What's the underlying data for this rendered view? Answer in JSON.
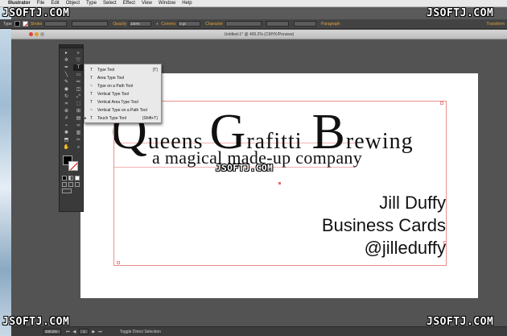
{
  "menubar": {
    "items": [
      "Illustrator",
      "File",
      "Edit",
      "Object",
      "Type",
      "Select",
      "Effect",
      "View",
      "Window",
      "Help"
    ]
  },
  "controlbar": {
    "tool_label": "Type",
    "stroke_label": "Stroke",
    "opacity_label": "Opacity",
    "opacity_value": "100%",
    "corners_label": "Corners",
    "corners_value": "0 pt",
    "character_label": "Character",
    "paragraph_label": "Paragraph",
    "transform_label": "Transform"
  },
  "document": {
    "title": "Untitled-1* @ 400.2% (CMYK/Preview)"
  },
  "artwork": {
    "line1_caps": [
      "Q",
      "G",
      "B"
    ],
    "line1_rests": [
      "ueens",
      "rafitti",
      "rewing"
    ],
    "tagline": "a magical made-up company",
    "name": "Jill Duffy",
    "subtitle": "Business Cards",
    "handle": "@jilleduffy"
  },
  "flyout": {
    "items": [
      {
        "label": "Type Tool",
        "shortcut": "(T)",
        "icon": "T",
        "checked": false
      },
      {
        "label": "Area Type Tool",
        "shortcut": "",
        "icon": "T",
        "checked": false
      },
      {
        "label": "Type on a Path Tool",
        "shortcut": "",
        "icon": "~",
        "checked": false
      },
      {
        "label": "Vertical Type Tool",
        "shortcut": "",
        "icon": "T",
        "checked": false
      },
      {
        "label": "Vertical Area Type Tool",
        "shortcut": "",
        "icon": "T",
        "checked": false
      },
      {
        "label": "Vertical Type on a Path Tool",
        "shortcut": "",
        "icon": "~",
        "checked": false
      },
      {
        "label": "Touch Type Tool",
        "shortcut": "(Shift+T)",
        "icon": "T",
        "checked": true
      }
    ]
  },
  "statusbar": {
    "zoom": "400.2%",
    "page": "1",
    "status": "Toggle Direct Selection"
  },
  "watermark": {
    "text": "JSOFTJ.COM"
  },
  "colors": {
    "accent": "#3a73d6",
    "selection": "#e88f8f",
    "panel": "#3a3a3a"
  }
}
